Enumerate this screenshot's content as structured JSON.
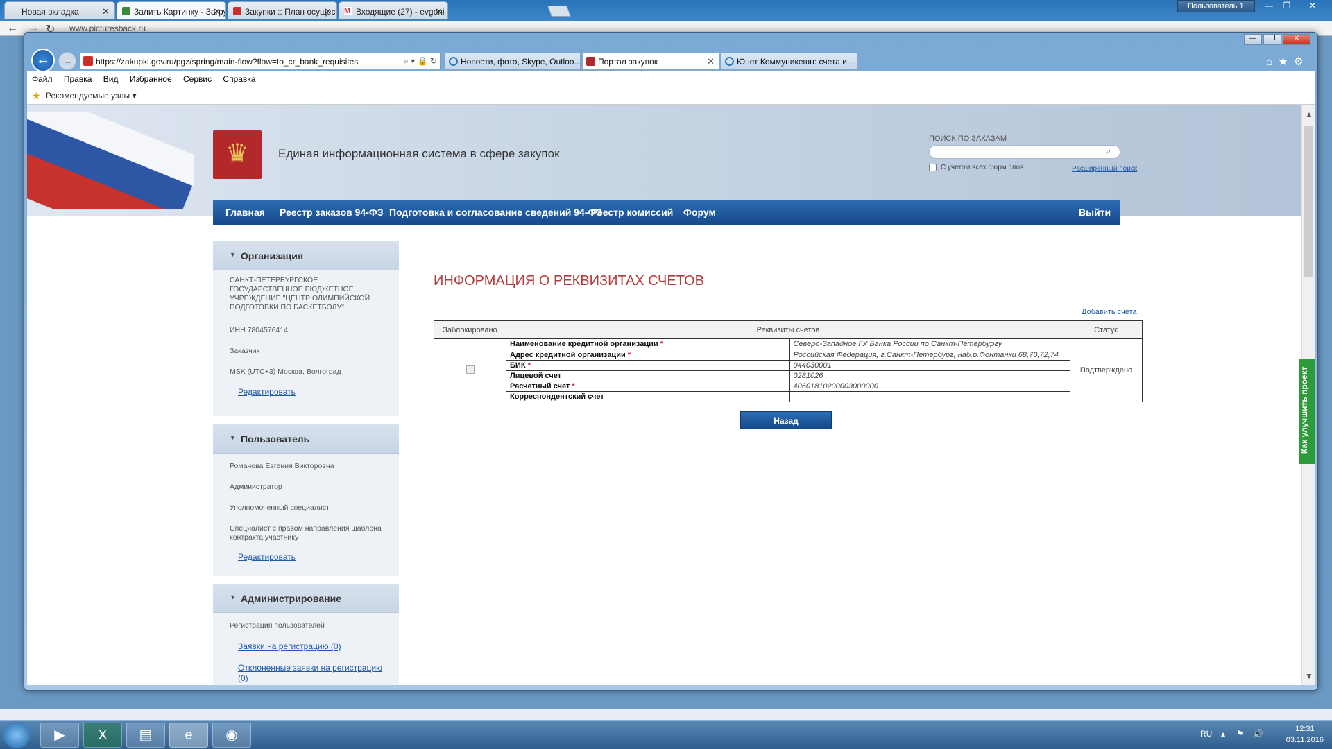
{
  "outer_browser": {
    "tabs": [
      {
        "label": "Новая вкладка"
      },
      {
        "label": "Залить Картинку - Загру"
      },
      {
        "label": "Закупки :: План осущест"
      },
      {
        "label": "Входящие (27) - evgeni"
      }
    ],
    "user_badge": "Пользователь 1",
    "url": "www.picturesback.ru"
  },
  "ie": {
    "address": "https://zakupki.gov.ru/pgz/spring/main-flow?flow=to_cr_bank_requisites",
    "tabs": [
      {
        "label": "Новости, фото, Skype, Outloo..."
      },
      {
        "label": "Портал закупок"
      },
      {
        "label": "Юнет Коммуникешн: счета и..."
      }
    ],
    "menu": [
      "Файл",
      "Правка",
      "Вид",
      "Избранное",
      "Сервис",
      "Справка"
    ],
    "favorites_label": "Рекомендуемые узлы ▾"
  },
  "site": {
    "title": "Единая информационная система в сфере закупок",
    "search": {
      "label": "ПОИСК ПО ЗАКАЗАМ",
      "option": "С учетом всех форм слов",
      "advanced": "Расширенный поиск"
    },
    "nav": [
      "Главная",
      "Реестр заказов 94-ФЗ",
      "Подготовка и согласование сведений 94-ФЗ",
      "Реестр комиссий",
      "Форум"
    ],
    "logout": "Выйти",
    "improve_tab": "Как улучшить проект"
  },
  "sidebar": {
    "organization": {
      "title": "Организация",
      "name": "САНКТ-ПЕТЕРБУРГСКОЕ ГОСУДАРСТВЕННОЕ БЮДЖЕТНОЕ УЧРЕЖДЕНИЕ \"ЦЕНТР ОЛИМПИЙСКОЙ ПОДГОТОВКИ ПО БАСКЕТБОЛУ\"",
      "inn": "ИНН 7804576414",
      "role": "Заказчик",
      "timezone": "MSK (UTC+3) Москва, Волгоград",
      "edit": "Редактировать"
    },
    "user": {
      "title": "Пользователь",
      "name": "Романова Евгения Викторовна",
      "role1": "Администратор",
      "role2": "Уполномоченный специалист",
      "role3": "Специалист с правом направления шаблона контракта участнику",
      "edit": "Редактировать"
    },
    "admin": {
      "title": "Администрирование",
      "item1": "Регистрация пользователей",
      "link1": "Заявки на регистрацию (0)",
      "link2": "Отклоненные заявки на регистрацию (0)"
    }
  },
  "content": {
    "title": "ИНФОРМАЦИЯ О РЕКВИЗИТАХ СЧЕТОВ",
    "add_link": "Добавить счета",
    "table": {
      "col_blocked": "Заблокировано",
      "col_requisites": "Реквизиты счетов",
      "col_status": "Статус",
      "rows": [
        {
          "key": "Наименование кредитной организации",
          "required": true,
          "value": "Северо-Западное ГУ Банка России по Санкт-Петербургу"
        },
        {
          "key": "Адрес кредитной организации",
          "required": true,
          "value": "Российская Федерация, г.Санкт-Петербург, наб.р.Фонтанки 68,70,72,74"
        },
        {
          "key": "БИК",
          "required": true,
          "value": "044030001"
        },
        {
          "key": "Лицевой счет",
          "required": false,
          "value": "0281026"
        },
        {
          "key": "Расчетный счет",
          "required": true,
          "value": "40601810200003000000"
        },
        {
          "key": "Корреспондентский счет",
          "required": false,
          "value": ""
        }
      ],
      "status": "Подтверждено"
    },
    "back_button": "Назад"
  },
  "taskbar": {
    "lang": "RU",
    "time": "12:31",
    "date": "03.11.2016"
  }
}
